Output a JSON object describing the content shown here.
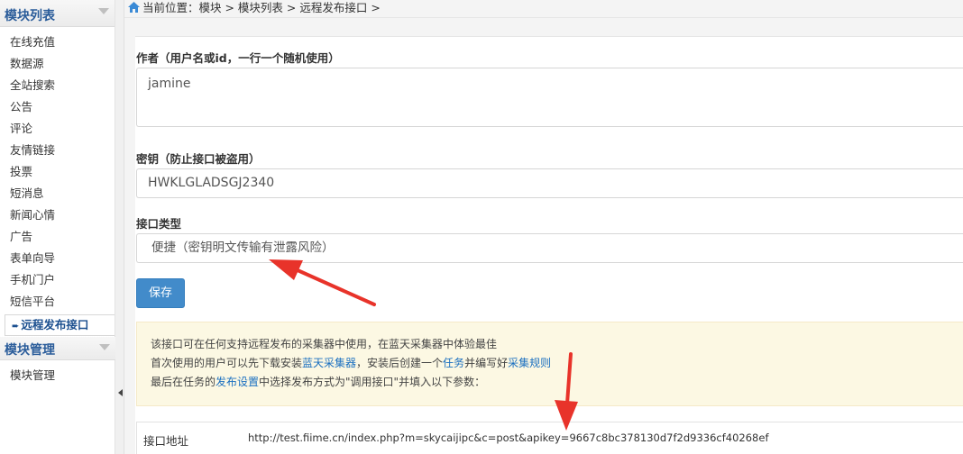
{
  "sidebar": {
    "section1_title": "模块列表",
    "items": [
      "在线充值",
      "数据源",
      "全站搜索",
      "公告",
      "评论",
      "友情链接",
      "投票",
      "短消息",
      "新闻心情",
      "广告",
      "表单向导",
      "手机门户",
      "短信平台"
    ],
    "active_item": "远程发布接口",
    "section2_title": "模块管理",
    "section2_items": [
      "模块管理"
    ]
  },
  "breadcrumb": "当前位置：模块 > 模块列表 > 远程发布接口 >",
  "form": {
    "author_label": "作者（用户名或id，一行一个随机使用）",
    "author_value": "jamine",
    "key_label": "密钥（防止接口被盗用）",
    "key_value": "HWKLGLADSGJ2340",
    "type_label": "接口类型",
    "type_value": "便捷（密钥明文传输有泄露风险）",
    "save_label": "保存"
  },
  "notice": {
    "line1": "该接口可在任何支持远程发布的采集器中使用，在蓝天采集器中体验最佳",
    "line2_a": "首次使用的用户可以先下载安装",
    "line2_link1": "蓝天采集器",
    "line2_b": "，安装后创建一个",
    "line2_link2": "任务",
    "line2_c": "并编写好",
    "line2_link3": "采集规则",
    "line3_a": "最后在任务的",
    "line3_link": "发布设置",
    "line3_b": "中选择发布方式为\"调用接口\"并填入以下参数："
  },
  "api": {
    "key": "接口地址",
    "value": "http://test.fiime.cn/index.php?m=skycaijipc&c=post&apikey=9667c8bc378130d7f2d9336cf40268ef"
  },
  "colors": {
    "accent": "#428bca",
    "annotation": "#e8332a",
    "notice_bg": "#fcf8e3",
    "sidebar_title": "#2a5c9a"
  }
}
